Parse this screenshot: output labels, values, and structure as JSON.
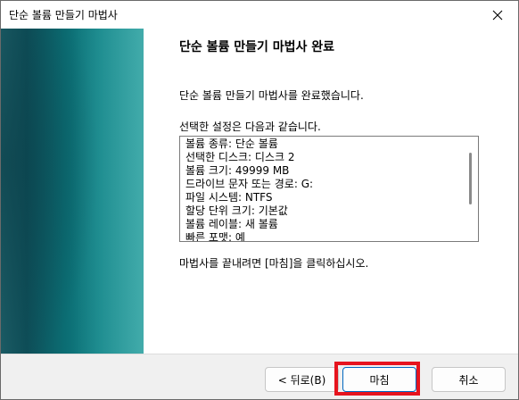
{
  "window": {
    "title": "단순 볼륨 만들기 마법사",
    "close_icon": "close-icon"
  },
  "content": {
    "heading": "단순 볼륨 만들기 마법사 완료",
    "completion_text": "단순 볼륨 만들기 마법사를 완료했습니다.",
    "settings_label": "선택한 설정은 다음과 같습니다.",
    "settings": [
      "볼륨 종류: 단순 볼륨",
      "선택한 디스크: 디스크 2",
      "볼륨 크기: 49999 MB",
      "드라이브 문자 또는 경로: G:",
      "파일 시스템: NTFS",
      "할당 단위 크기: 기본값",
      "볼륨 레이블: 새 볼륨",
      "빠른 포맷: 예"
    ],
    "finish_note": "마법사를 끝내려면 [마침]을 클릭하십시오."
  },
  "footer": {
    "back_label": "< 뒤로(B)",
    "finish_label": "마침",
    "cancel_label": "취소"
  },
  "colors": {
    "highlight": "#e6141e",
    "sidebar": "#0b6d73"
  }
}
